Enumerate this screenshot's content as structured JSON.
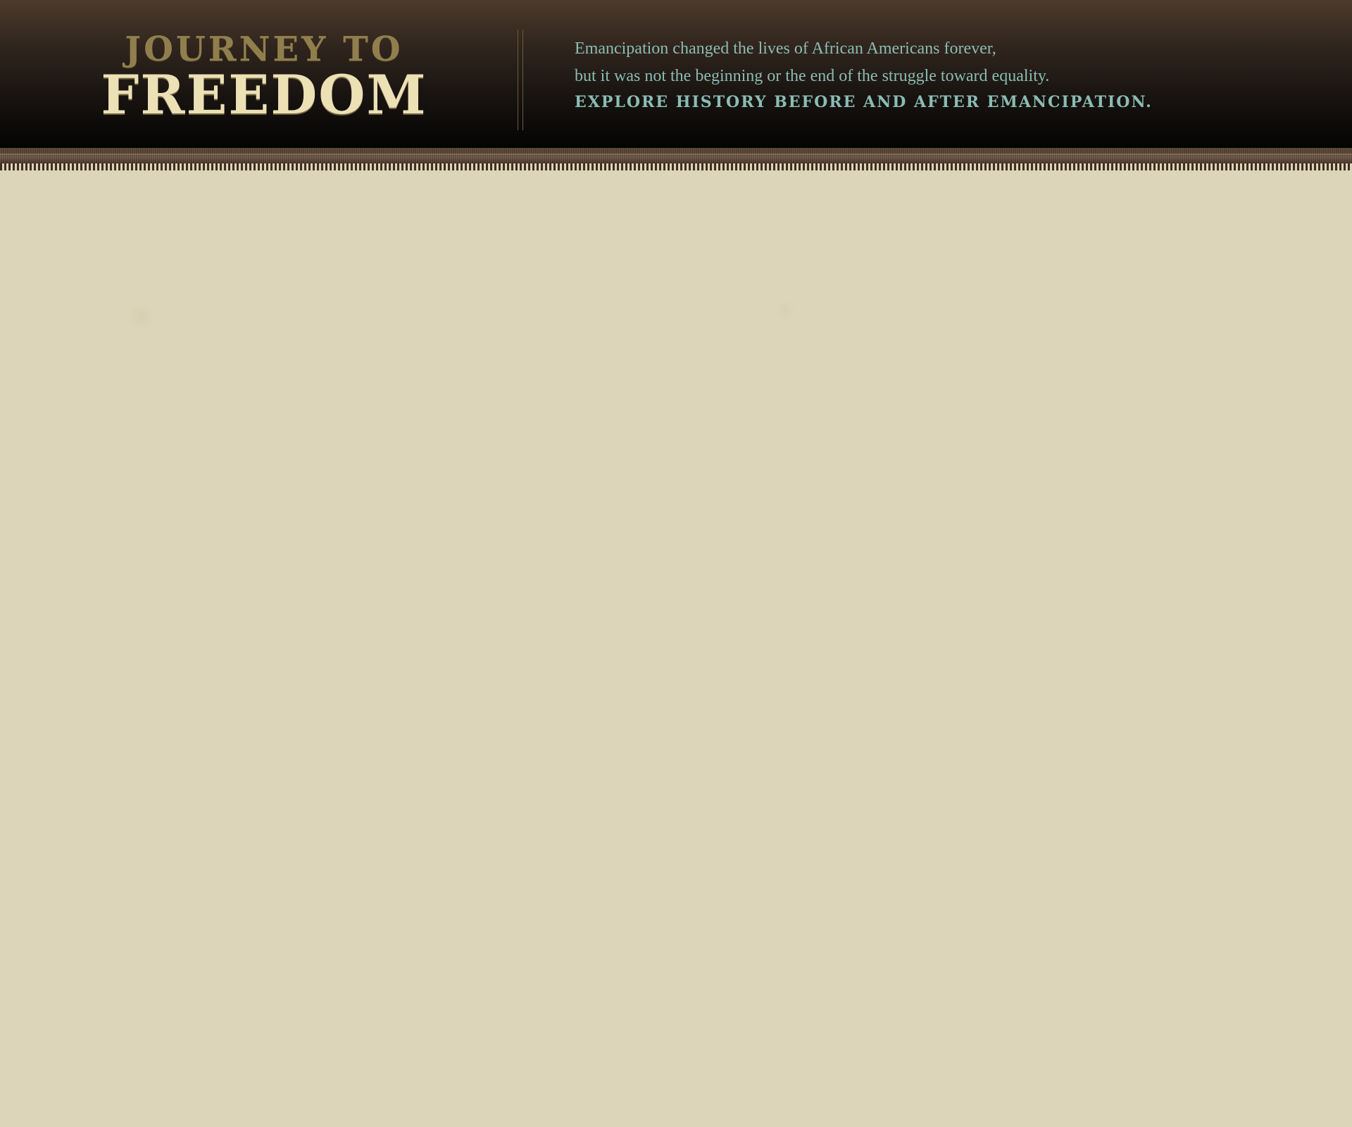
{
  "header": {
    "logo": {
      "line1": "JOURNEY TO",
      "line2": "FREEDOM"
    },
    "intro": {
      "line1": "Emancipation changed the lives of African Americans forever,",
      "line2": "but it was not the beginning or the end of the struggle toward equality.",
      "cta": "EXPLORE HISTORY BEFORE AND AFTER EMANCIPATION."
    }
  },
  "colors": {
    "header_background": "#1b1511",
    "logo_top": "#907f4d",
    "logo_main": "#ece0b5",
    "intro_text": "#8bbcb4",
    "trim": "#5a4536",
    "page_background": "#ddd5b9"
  }
}
